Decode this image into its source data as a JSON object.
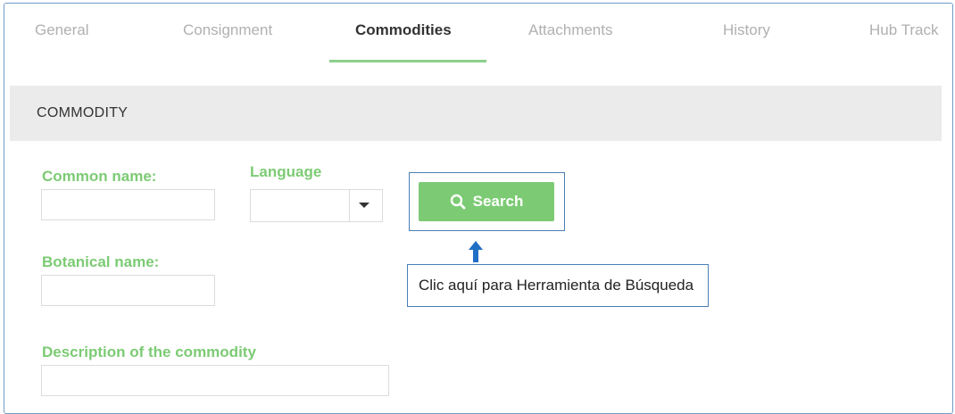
{
  "tabs": [
    {
      "label": "General"
    },
    {
      "label": "Consignment"
    },
    {
      "label": "Commodities"
    },
    {
      "label": "Attachments"
    },
    {
      "label": "History"
    },
    {
      "label": "Hub Track"
    }
  ],
  "active_tab": "Commodities",
  "section": {
    "title": "COMMODITY"
  },
  "form": {
    "common_name_label": "Common name:",
    "common_name_value": "",
    "language_label": "Language",
    "language_value": "",
    "botanical_name_label": "Botanical name:",
    "botanical_name_value": "",
    "description_label": "Description of the commodity",
    "description_value": ""
  },
  "search_button": {
    "label": "Search",
    "icon": "search-icon"
  },
  "callout": {
    "text": "Clic aquí para Herramienta de Búsqueda",
    "icon": "arrow-up-icon"
  },
  "colors": {
    "accent_green": "#7ccb74",
    "callout_blue": "#4a7fb5",
    "arrow_blue": "#1f6fc5"
  }
}
